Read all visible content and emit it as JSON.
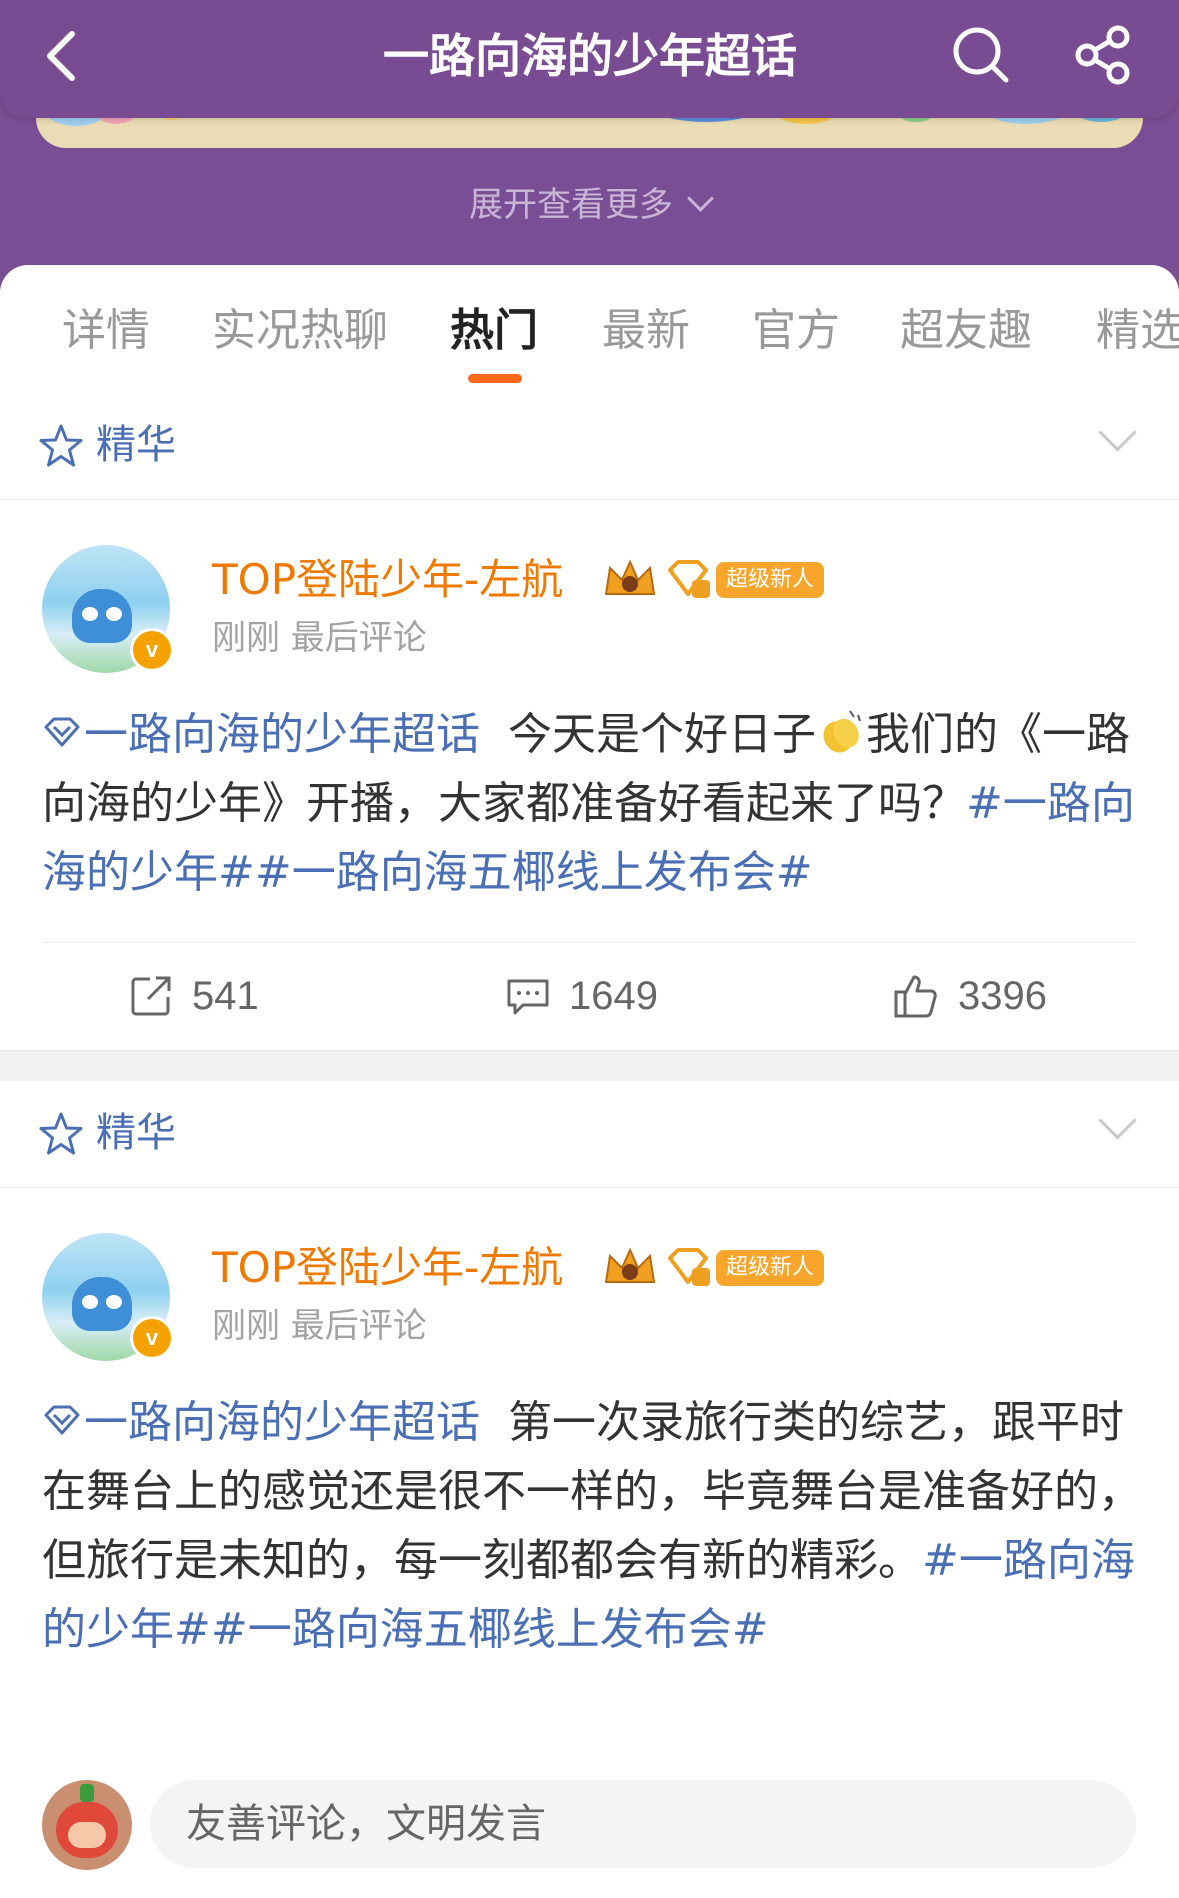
{
  "header": {
    "title": "一路向海的少年超话",
    "expand_label": "展开查看更多",
    "bg_color": "#794b93"
  },
  "tabs": [
    {
      "label": "详情",
      "active": false
    },
    {
      "label": "实况热聊",
      "active": false
    },
    {
      "label": "热门",
      "active": true
    },
    {
      "label": "最新",
      "active": false
    },
    {
      "label": "官方",
      "active": false
    },
    {
      "label": "超友趣",
      "active": false
    },
    {
      "label": "精选",
      "active": false
    }
  ],
  "accent_color": "#ff6a1a",
  "link_color": "#4a6fb5",
  "posts": [
    {
      "featured_label": "精华",
      "username": "TOP登陆少年-左航",
      "badge_new": "超级新人",
      "verified_mark": "v",
      "meta": "刚刚 最后评论",
      "topic": "一路向海的少年超话",
      "text_a": "今天是个好日子",
      "text_b": "我们的《一路向海的少年》开播，大家都准备好看起来了吗？",
      "hashtags": "#一路向海的少年##一路向海五椰线上发布会#",
      "reposts": "541",
      "comments": "1649",
      "likes": "3396"
    },
    {
      "featured_label": "精华",
      "username": "TOP登陆少年-左航",
      "badge_new": "超级新人",
      "verified_mark": "v",
      "meta": "刚刚 最后评论",
      "topic": "一路向海的少年超话",
      "text_a": "第一次录旅行类的综艺，跟平时在舞台上的感觉还是很不一样的，毕竟舞台是准备好的，但旅行是未知的，每一刻都都会有新的精彩。",
      "hashtags": "#一路向海的少年##一路向海五椰线上发布会#"
    }
  ],
  "comment_bar": {
    "placeholder": "友善评论，文明发言"
  }
}
